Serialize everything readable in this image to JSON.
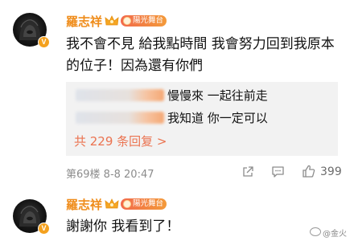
{
  "comment": {
    "username": "羅志祥",
    "fan_badge": "陽光舞台",
    "verified_mark": "V",
    "text_line1": "我不會不見 給我點時間 我會努力回到我原本",
    "text_line2": "的位子！因為還有你們",
    "replies": [
      {
        "text": "慢慢來 一起往前走"
      },
      {
        "text": "我知道 你一定可以"
      }
    ],
    "more_replies": "共 229 条回复 >",
    "floor_time": "第69楼 8-8 20:47",
    "like_count": "399",
    "icons": [
      "share-icon",
      "comment-icon",
      "like-icon"
    ]
  },
  "second_comment": {
    "username": "羅志祥",
    "fan_badge": "陽光舞台",
    "verified_mark": "V",
    "text": "謝謝你 我看到了！"
  },
  "watermark": {
    "text": "@金火"
  },
  "colors": {
    "username": "#ef8c1a",
    "link": "#eb7350",
    "reply_bg": "#f2f2f2",
    "meta": "#8c8c8c"
  }
}
